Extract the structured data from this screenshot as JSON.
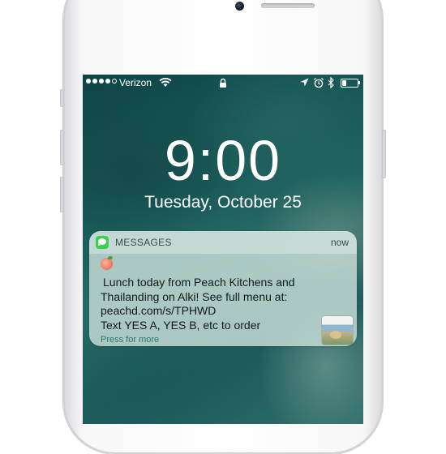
{
  "status_bar": {
    "carrier": "Verizon",
    "signal_bars": 4,
    "signal_max": 5,
    "icons": [
      "wifi-icon",
      "lock-icon",
      "location-icon",
      "alarm-icon",
      "bluetooth-icon",
      "battery-icon"
    ],
    "battery_level": 0.3
  },
  "lock_screen": {
    "time": "9:00",
    "date": "Tuesday, October 25"
  },
  "notification": {
    "app_name": "MESSAGES",
    "time": "now",
    "emoji": "🍑",
    "lines": [
      "Lunch today from Peach Kitchens and",
      "Thailanding on Alki! See full menu at:",
      "peachd.com/s/TPHWD",
      "Text YES A, YES B, etc to order"
    ],
    "action": "Press for more",
    "app_icon_color": "#3ccf4e"
  }
}
